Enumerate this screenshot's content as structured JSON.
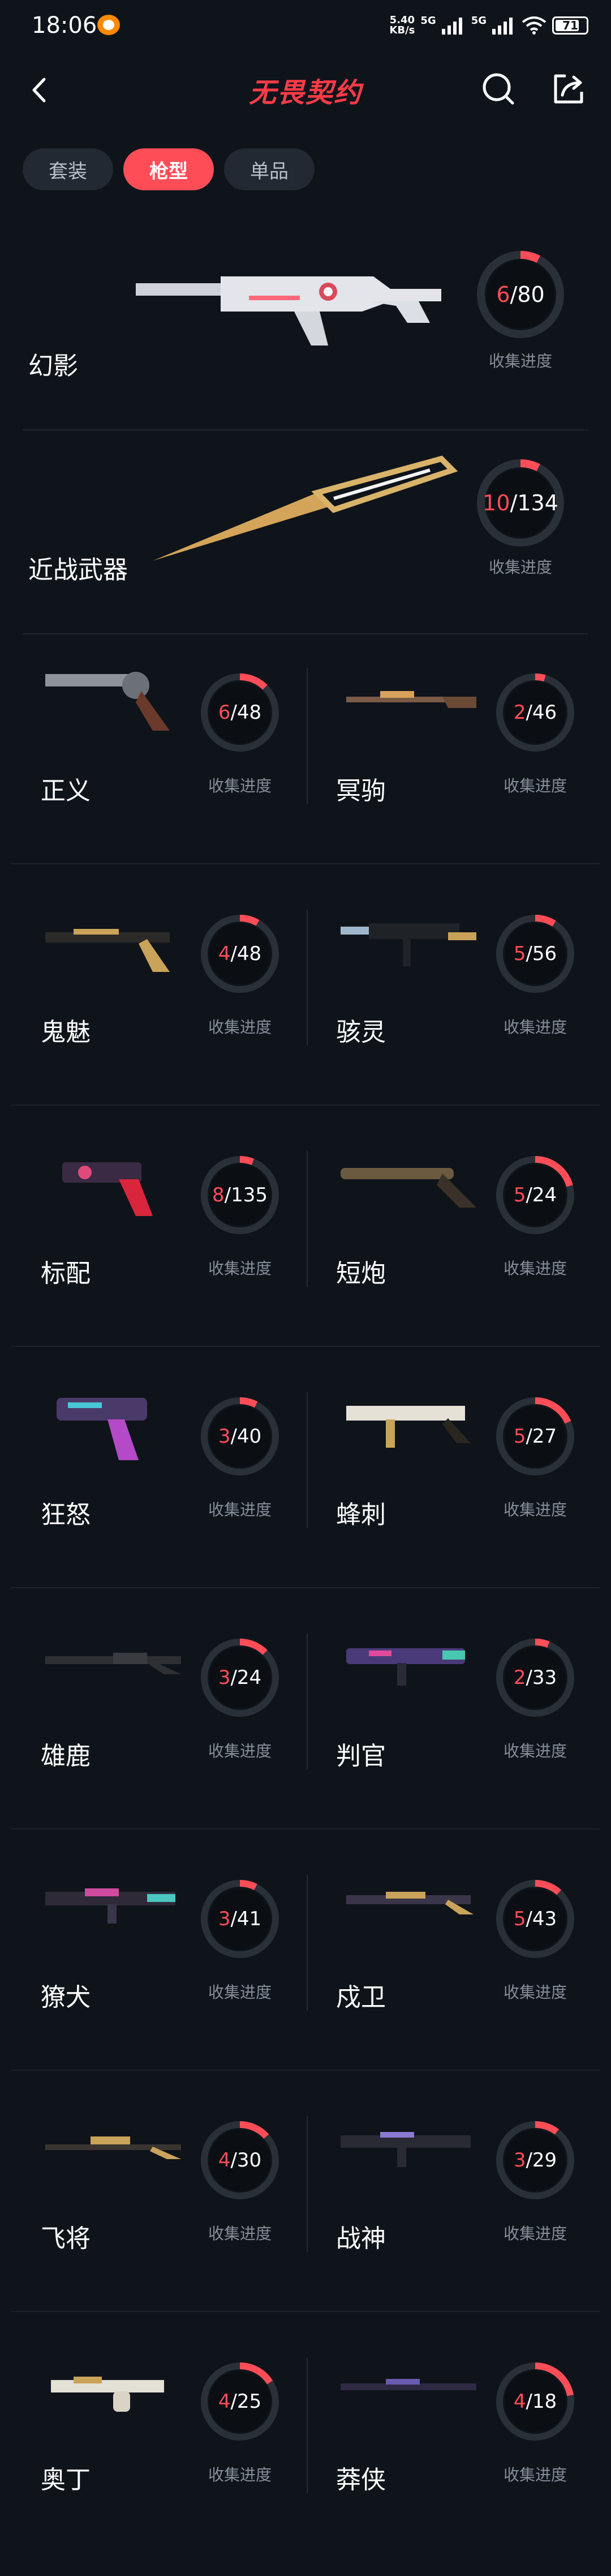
{
  "status_bar": {
    "time": "18:06",
    "net_speed_top": "5.40",
    "net_speed_bottom": "KB/s",
    "net_type_1": "5G",
    "net_type_2": "5G",
    "battery": "71"
  },
  "header": {
    "title": "无畏契约"
  },
  "tabs": [
    {
      "label": "套装",
      "active": false
    },
    {
      "label": "枪型",
      "active": true
    },
    {
      "label": "单品",
      "active": false
    }
  ],
  "caption": "收集进度",
  "featured": [
    {
      "name": "幻影",
      "collected": 6,
      "total": 80
    },
    {
      "name": "近战武器",
      "collected": 10,
      "total": 134
    }
  ],
  "weapons": [
    {
      "name": "正义",
      "collected": 6,
      "total": 48
    },
    {
      "name": "冥驹",
      "collected": 2,
      "total": 46
    },
    {
      "name": "鬼魅",
      "collected": 4,
      "total": 48
    },
    {
      "name": "骇灵",
      "collected": 5,
      "total": 56
    },
    {
      "name": "标配",
      "collected": 8,
      "total": 135
    },
    {
      "name": "短炮",
      "collected": 5,
      "total": 24
    },
    {
      "name": "狂怒",
      "collected": 3,
      "total": 40
    },
    {
      "name": "蜂刺",
      "collected": 5,
      "total": 27
    },
    {
      "name": "雄鹿",
      "collected": 3,
      "total": 24
    },
    {
      "name": "判官",
      "collected": 2,
      "total": 33
    },
    {
      "name": "獠犬",
      "collected": 3,
      "total": 41
    },
    {
      "name": "戍卫",
      "collected": 5,
      "total": 43
    },
    {
      "name": "飞将",
      "collected": 4,
      "total": 30
    },
    {
      "name": "战神",
      "collected": 3,
      "total": 29
    },
    {
      "name": "奥丁",
      "collected": 4,
      "total": 25
    },
    {
      "name": "莽侠",
      "collected": 4,
      "total": 18
    }
  ],
  "colors": {
    "accent": "#ff4d57",
    "background": "#0f141b",
    "ring_track": "#2a3038"
  }
}
